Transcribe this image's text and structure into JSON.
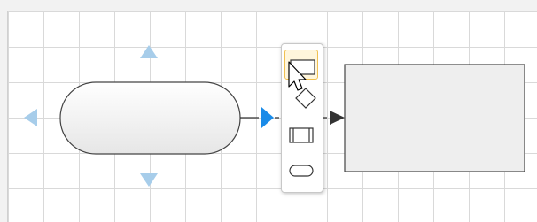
{
  "canvas": {
    "grid_color": "#d9d9d9",
    "background": "#ffffff"
  },
  "colors": {
    "hint_arrow": "#a7cdea",
    "active_arrow": "#1a8be8",
    "shape_fill": "#eeeeee",
    "shape_stroke": "#444444",
    "connector": "#333333",
    "selection_border": "#f0c050"
  },
  "diagram": {
    "shapes": [
      {
        "kind": "terminator",
        "text": ""
      },
      {
        "kind": "rectangle",
        "text": ""
      }
    ],
    "connector": {
      "from": "terminator",
      "to": "rectangle",
      "style": "dashed-arrow"
    }
  },
  "shape_picker": {
    "options": [
      {
        "name": "rectangle",
        "icon": "rectangle-icon",
        "selected": true
      },
      {
        "name": "diamond",
        "icon": "diamond-icon",
        "selected": false
      },
      {
        "name": "process",
        "icon": "process-icon",
        "selected": false
      },
      {
        "name": "terminator",
        "icon": "terminator-icon",
        "selected": false
      }
    ]
  },
  "cursor": {
    "icon": "mouse-pointer-icon"
  }
}
